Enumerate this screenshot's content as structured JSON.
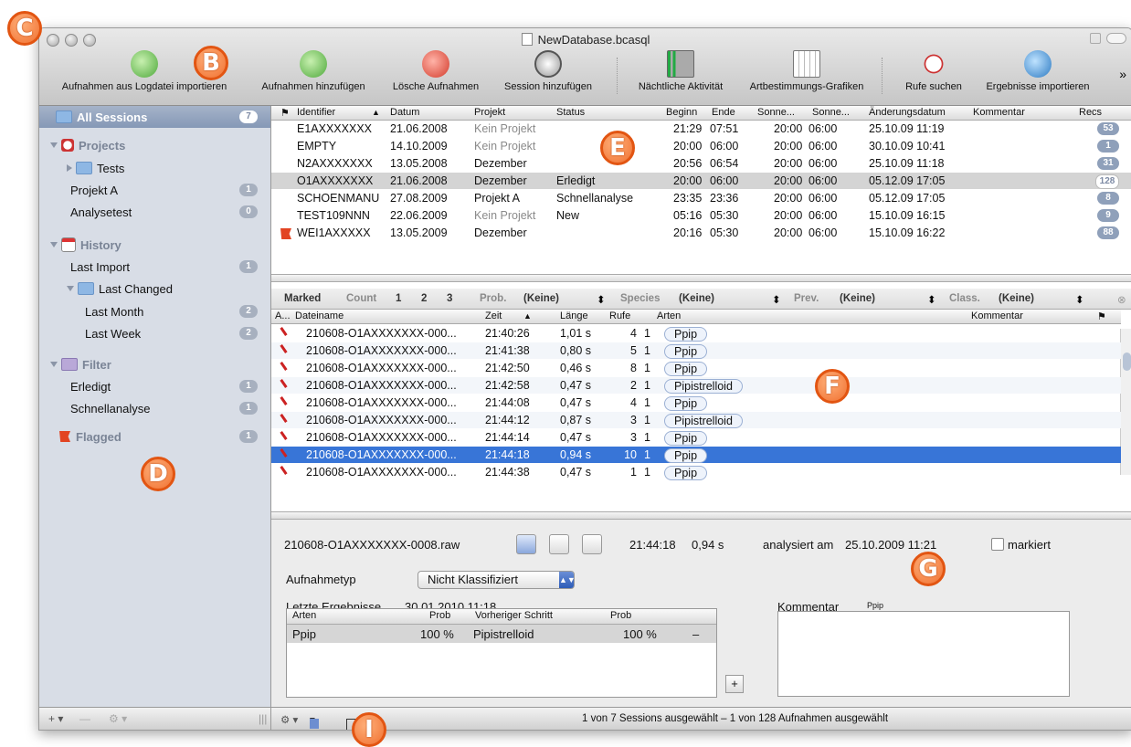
{
  "window": {
    "title": "NewDatabase.bcasql"
  },
  "toolbar": {
    "items": [
      {
        "label": "Aufnahmen aus Logdatei importieren",
        "icon": "import-log-icon"
      },
      {
        "label": "Aufnahmen hinzufügen",
        "icon": "add-recordings-icon"
      },
      {
        "label": "Lösche Aufnahmen",
        "icon": "delete-recordings-icon"
      },
      {
        "label": "Session hinzufügen",
        "icon": "add-session-icon"
      },
      {
        "label": "Nächtliche Aktivität",
        "icon": "nightly-activity-icon"
      },
      {
        "label": "Artbestimmungs-Grafiken",
        "icon": "species-graphics-icon"
      },
      {
        "label": "Rufe suchen",
        "icon": "search-calls-icon"
      },
      {
        "label": "Ergebnisse importieren",
        "icon": "import-results-icon"
      }
    ],
    "overflow": "»"
  },
  "sidebar": {
    "all_sessions": {
      "label": "All Sessions",
      "count": "7"
    },
    "projects": {
      "label": "Projects"
    },
    "tests": {
      "label": "Tests"
    },
    "projekt_a": {
      "label": "Projekt A",
      "count": "1"
    },
    "analysetest": {
      "label": "Analysetest",
      "count": "0"
    },
    "history": {
      "label": "History"
    },
    "last_import": {
      "label": "Last Import",
      "count": "1"
    },
    "last_changed": {
      "label": "Last Changed"
    },
    "last_month": {
      "label": "Last Month",
      "count": "2"
    },
    "last_week": {
      "label": "Last Week",
      "count": "2"
    },
    "filter": {
      "label": "Filter"
    },
    "erledigt": {
      "label": "Erledigt",
      "count": "1"
    },
    "schnellanalyse": {
      "label": "Schnellanalyse",
      "count": "1"
    },
    "flagged": {
      "label": "Flagged",
      "count": "1"
    },
    "bottom": {
      "add": "+ ▾",
      "remove": "—",
      "gear": "⚙ ▾"
    }
  },
  "sessions": {
    "headers": {
      "flag": "⚑",
      "identifier": "Identifier",
      "datum": "Datum",
      "projekt": "Projekt",
      "status": "Status",
      "beginn": "Beginn",
      "ende": "Ende",
      "sonne1": "Sonne...",
      "sonne2": "Sonne...",
      "aenderung": "Änderungsdatum",
      "kommentar": "Kommentar",
      "recs": "Recs"
    },
    "rows": [
      {
        "id": "E1AXXXXXXX",
        "datum": "21.06.2008",
        "projekt": "Kein Projekt",
        "status": "",
        "beginn": "21:29",
        "ende": "07:51",
        "s1": "20:00",
        "s2": "06:00",
        "aend": "25.10.09 11:19",
        "recs": "53"
      },
      {
        "id": "EMPTY",
        "datum": "14.10.2009",
        "projekt": "Kein Projekt",
        "status": "",
        "beginn": "20:00",
        "ende": "06:00",
        "s1": "20:00",
        "s2": "06:00",
        "aend": "30.10.09 10:41",
        "recs": "1"
      },
      {
        "id": "N2AXXXXXXX",
        "datum": "13.05.2008",
        "projekt": "Dezember",
        "status": "",
        "beginn": "20:56",
        "ende": "06:54",
        "s1": "20:00",
        "s2": "06:00",
        "aend": "25.10.09 11:18",
        "recs": "31"
      },
      {
        "id": "O1AXXXXXXX",
        "datum": "21.06.2008",
        "projekt": "Dezember",
        "status": "Erledigt",
        "beginn": "20:00",
        "ende": "06:00",
        "s1": "20:00",
        "s2": "06:00",
        "aend": "05.12.09 17:05",
        "recs": "128"
      },
      {
        "id": "SCHOENMANU",
        "datum": "27.08.2009",
        "projekt": "Projekt A",
        "status": "Schnellanalyse",
        "beginn": "23:35",
        "ende": "23:36",
        "s1": "20:00",
        "s2": "06:00",
        "aend": "05.12.09 17:05",
        "recs": "8"
      },
      {
        "id": "TEST109NNN",
        "datum": "22.06.2009",
        "projekt": "Kein Projekt",
        "status": "New",
        "beginn": "05:16",
        "ende": "05:30",
        "s1": "20:00",
        "s2": "06:00",
        "aend": "15.10.09 16:15",
        "recs": "9"
      },
      {
        "id": "WEI1AXXXXX",
        "datum": "13.05.2009",
        "projekt": "Dezember",
        "status": "",
        "beginn": "20:16",
        "ende": "05:30",
        "s1": "20:00",
        "s2": "06:00",
        "aend": "15.10.09 16:22",
        "recs": "88"
      }
    ]
  },
  "filterbar": {
    "marked": "Marked",
    "count": "Count",
    "c1": "1",
    "c2": "2",
    "c3": "3",
    "prob": "Prob.",
    "prob_val": "(Keine)",
    "species": "Species",
    "species_val": "(Keine)",
    "prev": "Prev.",
    "prev_val": "(Keine)",
    "class": "Class.",
    "class_val": "(Keine)"
  },
  "recordings": {
    "headers": {
      "a": "A...",
      "dateiname": "Dateiname",
      "zeit": "Zeit",
      "laenge": "Länge",
      "rufe": "Rufe",
      "arten": "Arten",
      "kommentar": "Kommentar",
      "flag": "⚑"
    },
    "rows": [
      {
        "name": "210608-O1AXXXXXXX-000...",
        "zeit": "21:40:26",
        "laenge": "1,01 s",
        "rufe": "4",
        "n": "1",
        "art": "Ppip"
      },
      {
        "name": "210608-O1AXXXXXXX-000...",
        "zeit": "21:41:38",
        "laenge": "0,80 s",
        "rufe": "5",
        "n": "1",
        "art": "Ppip"
      },
      {
        "name": "210608-O1AXXXXXXX-000...",
        "zeit": "21:42:50",
        "laenge": "0,46 s",
        "rufe": "8",
        "n": "1",
        "art": "Ppip"
      },
      {
        "name": "210608-O1AXXXXXXX-000...",
        "zeit": "21:42:58",
        "laenge": "0,47 s",
        "rufe": "2",
        "n": "1",
        "art": "Pipistrelloid"
      },
      {
        "name": "210608-O1AXXXXXXX-000...",
        "zeit": "21:44:08",
        "laenge": "0,47 s",
        "rufe": "4",
        "n": "1",
        "art": "Ppip"
      },
      {
        "name": "210608-O1AXXXXXXX-000...",
        "zeit": "21:44:12",
        "laenge": "0,87 s",
        "rufe": "3",
        "n": "1",
        "art": "Pipistrelloid"
      },
      {
        "name": "210608-O1AXXXXXXX-000...",
        "zeit": "21:44:14",
        "laenge": "0,47 s",
        "rufe": "3",
        "n": "1",
        "art": "Ppip"
      },
      {
        "name": "210608-O1AXXXXXXX-000...",
        "zeit": "21:44:18",
        "laenge": "0,94 s",
        "rufe": "10",
        "n": "1",
        "art": "Ppip"
      },
      {
        "name": "210608-O1AXXXXXXX-000...",
        "zeit": "21:44:38",
        "laenge": "0,47 s",
        "rufe": "1",
        "n": "1",
        "art": "Ppip"
      }
    ]
  },
  "detail": {
    "filename": "210608-O1AXXXXXXX-0008.raw",
    "time": "21:44:18",
    "length": "0,94 s",
    "analysed": "analysiert am",
    "analysed_date": "25.10.2009 11:21",
    "marked": "markiert",
    "type_label": "Aufnahmetyp",
    "type_value": "Nicht Klassifiziert",
    "last_results_label": "Letzte Ergebnisse",
    "last_results_date": "30.01.2010 11:18",
    "comment_label": "Kommentar",
    "comment_value": "Ppip",
    "results_headers": {
      "arten": "Arten",
      "prob": "Prob",
      "prev": "Vorheriger Schritt",
      "prob2": "Prob"
    },
    "results_row": {
      "arten": "Ppip",
      "prob": "100 %",
      "prev": "Pipistrelloid",
      "prob2": "100 %",
      "dash": "–"
    },
    "add": "+"
  },
  "status": {
    "text": "1 von 7 Sessions ausgewählt – 1 von 128 Aufnahmen ausgewählt"
  },
  "markers": {
    "b": "B",
    "c": "C",
    "d": "D",
    "e": "E",
    "f": "F",
    "g": "G",
    "i": "I"
  }
}
